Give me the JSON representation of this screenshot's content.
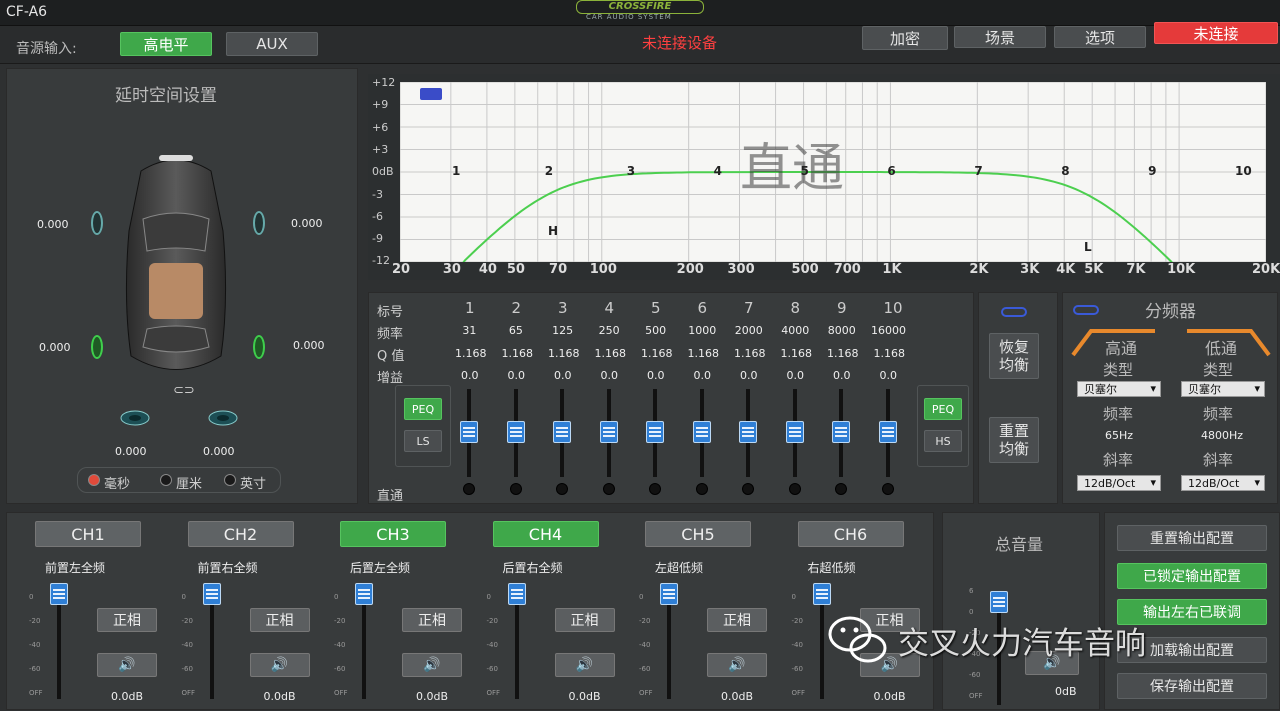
{
  "app": {
    "title": "CF-A6",
    "logo_text": "CROSSFIRE",
    "logo_sub": "CAR AUDIO SYSTEM"
  },
  "topbar": {
    "source_label": "音源输入:",
    "src_high": "高电平",
    "src_aux": "AUX",
    "status": "未连接设备",
    "btn_encrypt": "加密",
    "btn_scene": "场景",
    "btn_options": "选项",
    "btn_connect": "未连接",
    "connect_color": "#e53a3a"
  },
  "delay": {
    "title": "延时空间设置",
    "fl": "0.000",
    "fr": "0.000",
    "rl": "0.000",
    "rr": "0.000",
    "sub_l": "0.000",
    "sub_r": "0.000",
    "units": [
      "毫秒",
      "厘米",
      "英寸"
    ],
    "selected_unit": "毫秒",
    "link_icon": "link-icon"
  },
  "eq_graph": {
    "yticks": [
      "+12",
      "+9",
      "+6",
      "+3",
      "0dB",
      "-3",
      "-6",
      "-9",
      "-12"
    ],
    "xticks": [
      "20",
      "30",
      "40",
      "50",
      "70",
      "100",
      "200",
      "300",
      "500",
      "700",
      "1K",
      "2K",
      "3K",
      "4K",
      "5K",
      "7K",
      "10K",
      "20K"
    ],
    "overlay": "直通",
    "band_labels": [
      "1",
      "2",
      "3",
      "4",
      "5",
      "6",
      "7",
      "8",
      "9",
      "10"
    ],
    "hp_marker": "H",
    "lp_marker": "L",
    "curve_color": "#4ccf4f"
  },
  "eq_table": {
    "row_labels": [
      "标号",
      "频率",
      "Q 值",
      "增益"
    ],
    "bypass_label": "直通",
    "bands": [
      {
        "no": "1",
        "freq": "31",
        "q": "1.168",
        "gain": "0.0"
      },
      {
        "no": "2",
        "freq": "65",
        "q": "1.168",
        "gain": "0.0"
      },
      {
        "no": "3",
        "freq": "125",
        "q": "1.168",
        "gain": "0.0"
      },
      {
        "no": "4",
        "freq": "250",
        "q": "1.168",
        "gain": "0.0"
      },
      {
        "no": "5",
        "freq": "500",
        "q": "1.168",
        "gain": "0.0"
      },
      {
        "no": "6",
        "freq": "1000",
        "q": "1.168",
        "gain": "0.0"
      },
      {
        "no": "7",
        "freq": "2000",
        "q": "1.168",
        "gain": "0.0"
      },
      {
        "no": "8",
        "freq": "4000",
        "q": "1.168",
        "gain": "0.0"
      },
      {
        "no": "9",
        "freq": "8000",
        "q": "1.168",
        "gain": "0.0"
      },
      {
        "no": "10",
        "freq": "16000",
        "q": "1.168",
        "gain": "0.0"
      }
    ],
    "peq_left": "PEQ",
    "ls": "LS",
    "peq_right": "PEQ",
    "hs": "HS",
    "restore": "恢复均衡",
    "reset": "重置均衡"
  },
  "crossover": {
    "title": "分频器",
    "hp_title": "高通",
    "lp_title": "低通",
    "type_label": "类型",
    "freq_label": "频率",
    "slope_label": "斜率",
    "hp_type": "贝塞尔",
    "lp_type": "贝塞尔",
    "hp_freq": "65Hz",
    "lp_freq": "4800Hz",
    "hp_slope": "12dB/Oct",
    "lp_slope": "12dB/Oct"
  },
  "channels": [
    {
      "name": "CH1",
      "label": "前置左全频",
      "phase": "正相",
      "value": "0.0dB",
      "active": false
    },
    {
      "name": "CH2",
      "label": "前置右全频",
      "phase": "正相",
      "value": "0.0dB",
      "active": false
    },
    {
      "name": "CH3",
      "label": "后置左全频",
      "phase": "正相",
      "value": "0.0dB",
      "active": true
    },
    {
      "name": "CH4",
      "label": "后置右全频",
      "phase": "正相",
      "value": "0.0dB",
      "active": true
    },
    {
      "name": "CH5",
      "label": "左超低频",
      "phase": "正相",
      "value": "0.0dB",
      "active": false
    },
    {
      "name": "CH6",
      "label": "右超低频",
      "phase": "正相",
      "value": "0.0dB",
      "active": false
    }
  ],
  "fader_scale": [
    "0",
    "-20",
    "-40",
    "-60",
    "OFF"
  ],
  "master": {
    "label": "总音量",
    "value": "0dB",
    "scale": [
      "6",
      "0",
      "-20",
      "-40",
      "-60",
      "OFF"
    ]
  },
  "output": {
    "reset": "重置输出配置",
    "locked": "已锁定输出配置",
    "linked": "输出左右已联调",
    "load": "加载输出配置",
    "save": "保存输出配置"
  },
  "watermark": "交叉火力汽车音响"
}
